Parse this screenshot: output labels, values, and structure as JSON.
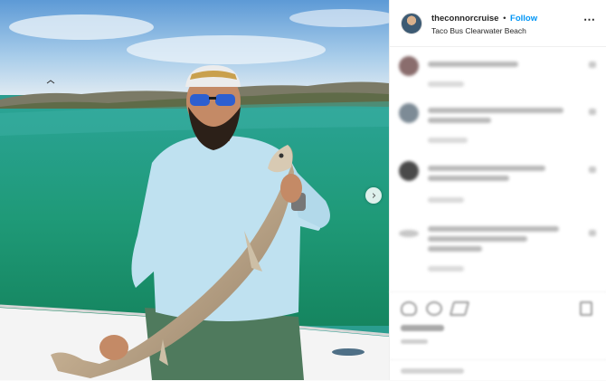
{
  "post": {
    "username": "theconnorcruise",
    "separator": "•",
    "follow_label": "Follow",
    "location": "Taco Bus Clearwater Beach",
    "more_icon": "⋯",
    "next_icon": "›"
  },
  "photo": {
    "description_icon": "fishing-photo",
    "colors": {
      "sky": "#7fb4e0",
      "water": "#1f9e86",
      "shirt": "#bfe3f2",
      "fish": "#c7b49a"
    }
  },
  "comments_blurred": 4,
  "icons": {
    "like": "heart-icon",
    "comment": "comment-icon",
    "share": "share-icon",
    "save": "bookmark-icon"
  }
}
